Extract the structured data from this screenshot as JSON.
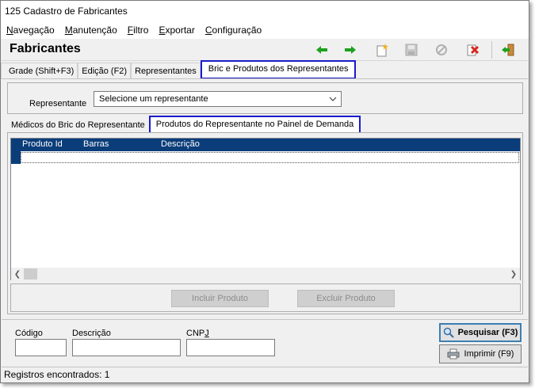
{
  "window": {
    "title": "125 Cadastro de Fabricantes"
  },
  "menu": [
    {
      "mnemonic": "N",
      "rest": "avegação"
    },
    {
      "mnemonic": "M",
      "rest": "anutenção"
    },
    {
      "mnemonic": "F",
      "rest": "iltro"
    },
    {
      "mnemonic": "E",
      "rest": "xportar"
    },
    {
      "mnemonic": "C",
      "rest": "onfiguração"
    }
  ],
  "header": {
    "title": "Fabricantes"
  },
  "tabs": [
    "Grade (Shift+F3)",
    "Edição (F2)",
    "Representantes",
    "Bric e Produtos dos Representantes"
  ],
  "representante": {
    "label": "Representante",
    "selected": "Selecione um representante"
  },
  "subtabs": [
    "Médicos do Bric do Representante",
    "Produtos do Representante no Painel de Demanda"
  ],
  "grid": {
    "columns": [
      "Produto Id",
      "Barras",
      "Descrição"
    ]
  },
  "buttons": {
    "incluir": "Incluir Produto",
    "excluir": "Excluir Produto",
    "pesquisar": "Pesquisar (F3)",
    "imprimir": "Imprimir (F9)"
  },
  "search": {
    "codigo_label": "Código",
    "descricao_label": "Descrição",
    "cnpj_prefix": "CNP",
    "cnpj_mnemonic": "J",
    "codigo_value": "",
    "descricao_value": "",
    "cnpj_value": ""
  },
  "status": {
    "text": "Registros encontrados: 1"
  },
  "colors": {
    "grid_header": "#0b3d7a",
    "tab_highlight": "#1a1acc",
    "arrow_green": "#1fa11f",
    "delete_red": "#d9261c"
  },
  "icons": [
    "back-arrow-icon",
    "forward-arrow-icon",
    "new-record-icon",
    "save-icon",
    "cancel-icon",
    "delete-icon",
    "exit-icon",
    "search-icon",
    "printer-icon",
    "chevron-down-icon"
  ]
}
